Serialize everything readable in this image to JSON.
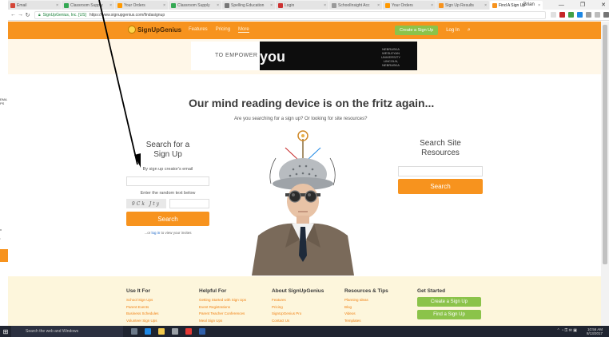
{
  "browser": {
    "tabs": [
      {
        "label": "Email",
        "color": "#d44638"
      },
      {
        "label": "Classroom Supply",
        "color": "#34a853"
      },
      {
        "label": "Your Orders",
        "color": "#ff9900"
      },
      {
        "label": "Classroom Supply",
        "color": "#34a853"
      },
      {
        "label": "Spelling Education",
        "color": "#777777"
      },
      {
        "label": "Login",
        "color": "#cc3333"
      },
      {
        "label": "SchoolInsight Acc",
        "color": "#999999"
      },
      {
        "label": "Your Orders",
        "color": "#ff9900"
      },
      {
        "label": "Sign Up Results",
        "color": "#f7931e"
      },
      {
        "label": "Find A Sign Up",
        "color": "#f7931e"
      }
    ],
    "user": "Brian",
    "url_secure": "SignUpGenius, Inc. [US]",
    "url": "https://www.signupgenius.com/findasignup"
  },
  "site": {
    "logo": "SignUpGenius",
    "nav": [
      "Features",
      "Pricing",
      "More"
    ],
    "create_button": "Create a Sign Up",
    "login": "Log In",
    "ad": {
      "left": "TO EMPOWER",
      "you": "you",
      "uni": "NEBRASKA WESLEYAN UNIVERSITY LINCOLN, NEBRASKA"
    }
  },
  "main": {
    "headline": "Our mind reading device is on the fritz again...",
    "subline": "Are you searching for a sign up? Or looking for site resources?",
    "search_signup": {
      "title_line1": "Search for a",
      "title_line2": "Sign Up",
      "email_label": "By sign up creator's email",
      "random_label": "Enter the random text below",
      "captcha_text": "9Ck Jty",
      "button": "Search",
      "login_prefix": "...or ",
      "login_link": "log in",
      "login_suffix": " to view your invites"
    },
    "search_resources": {
      "title_line1": "Search Site",
      "title_line2": "Resources",
      "button": "Search"
    }
  },
  "footer": {
    "use_it_for": {
      "title": "Use It For",
      "items": [
        "School Sign Ups",
        "Parent Events",
        "Business Schedules",
        "Volunteer Sign Ups"
      ]
    },
    "helpful_for": {
      "title": "Helpful For",
      "items": [
        "Getting Started with Sign Ups",
        "Event Registrations",
        "Parent Teacher Conferences",
        "Meal Sign Ups"
      ]
    },
    "about": {
      "title": "About SignUpGenius",
      "items": [
        "Features",
        "Pricing",
        "SignUpGenius Pro",
        "Contact Us"
      ]
    },
    "resources": {
      "title": "Resources & Tips",
      "items": [
        "Planning Ideas",
        "Blog",
        "Videos",
        "Templates"
      ]
    },
    "get_started": {
      "title": "Get Started",
      "buttons": [
        "Create a Sign Up",
        "Find a Sign Up"
      ]
    }
  },
  "side": {
    "a": "EMA\nPS",
    "b": "x",
    "c": ":"
  },
  "taskbar": {
    "search": "Search the web and Windows",
    "time": "10:56 AM",
    "date": "8/13/2017"
  },
  "colors": {
    "brand_orange": "#f7931e",
    "brand_green": "#8bc34a"
  }
}
